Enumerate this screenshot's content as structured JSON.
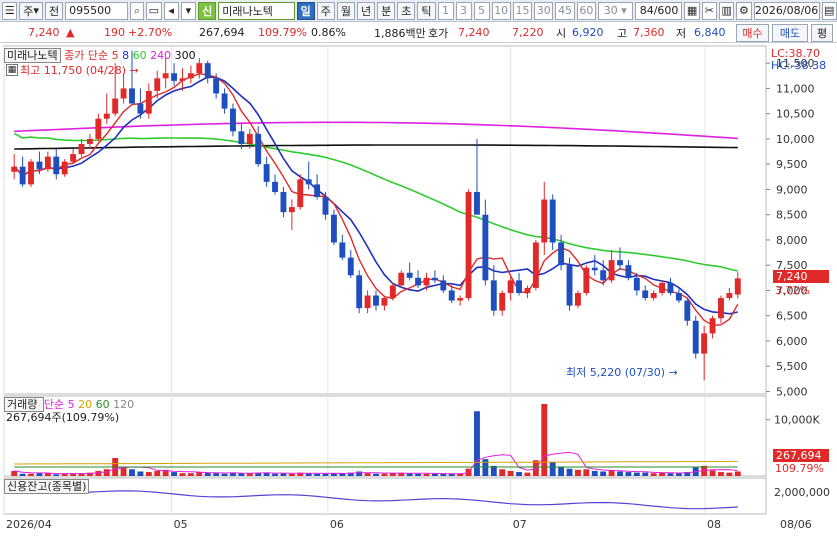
{
  "toolbar": {
    "market": "주",
    "prev": "전",
    "code": "095500",
    "badge": "신",
    "stock_name": "미래나노텍",
    "periods": [
      "일",
      "주",
      "월",
      "년",
      "분",
      "초",
      "틱"
    ],
    "active_period": "일",
    "intervals": [
      "1",
      "3",
      "5",
      "10",
      "15",
      "30",
      "45",
      "60",
      "30"
    ],
    "count": "84",
    "count_max": "/600",
    "date": "2026/08/06"
  },
  "infobar": {
    "price": "7,240",
    "arrow": "▲",
    "change": "190",
    "change_pct": "+2.70%",
    "volume": "267,694",
    "vol_ratio": "109.79%",
    "turnover": "0.86%",
    "value": "1,886백만",
    "quote_label": "호가",
    "ask": "7,240",
    "bid": "7,220",
    "open_label": "시",
    "open": "6,920",
    "high_label": "고",
    "high": "7,360",
    "low_label": "저",
    "low": "6,840",
    "buy": "매수",
    "sell": "매도",
    "eval": "평"
  },
  "legend": {
    "stock": "미래나노텍",
    "ma_label": "종가 단순",
    "ma_periods": [
      "5",
      "8",
      "60",
      "240",
      "300"
    ],
    "max_label": "최고 11,750 (04/28)",
    "min_label": "최저 5,220 (07/30)",
    "lc": "LC:38.70",
    "hc": "HC:-38.38",
    "price_tag": "7,240",
    "pct_tag": "3.72%",
    "volume_title": "거래량",
    "volume_ma_label": "단순",
    "volume_ma_periods": [
      "5",
      "20",
      "60",
      "120"
    ],
    "volume_value": "267,694주(109.79%)",
    "volume_tag": "267,694",
    "volume_pct_tag": "109.79%",
    "credit_title": "신용잔고(종목별)"
  },
  "colors": {
    "up": "#e02a2a",
    "down": "#1f4fbf",
    "ma5": "#e02a2a",
    "ma8": "#1f2fbf",
    "ma60": "#2ecc2e",
    "ma240": "#e020e0",
    "ma300": "#111111"
  },
  "chart_data": {
    "type": "candlestick",
    "x_labels": [
      "2026/04",
      "05",
      "06",
      "07",
      "08",
      "08/06"
    ],
    "price_axis_ticks": [
      "11,500",
      "11,000",
      "10,500",
      "10,000",
      "9,500",
      "9,000",
      "8,500",
      "8,000",
      "7,500",
      "7,000",
      "6,500",
      "6,000",
      "5,500",
      "5,000"
    ],
    "price_range": [
      4950,
      11800
    ],
    "volume_axis_ticks": [
      "10,000K"
    ],
    "credit_axis_ticks": [
      "2,000,000"
    ],
    "candles": [
      [
        9350,
        9700,
        9200,
        9450
      ],
      [
        9450,
        9650,
        9050,
        9100
      ],
      [
        9100,
        9600,
        9050,
        9550
      ],
      [
        9550,
        9750,
        9300,
        9400
      ],
      [
        9400,
        9750,
        9350,
        9650
      ],
      [
        9650,
        9800,
        9200,
        9300
      ],
      [
        9300,
        9600,
        9250,
        9550
      ],
      [
        9550,
        9800,
        9500,
        9700
      ],
      [
        9700,
        10000,
        9650,
        9900
      ],
      [
        9900,
        10100,
        9800,
        10000
      ],
      [
        10000,
        10500,
        9950,
        10400
      ],
      [
        10400,
        10900,
        10300,
        10500
      ],
      [
        10500,
        11500,
        10450,
        10800
      ],
      [
        10800,
        11300,
        10700,
        11000
      ],
      [
        11000,
        11750,
        10800,
        10700
      ],
      [
        10700,
        11000,
        10400,
        10500
      ],
      [
        10500,
        11100,
        10400,
        10950
      ],
      [
        10950,
        11350,
        10800,
        11200
      ],
      [
        11200,
        11600,
        11000,
        11300
      ],
      [
        11300,
        11500,
        11050,
        11150
      ],
      [
        11150,
        11400,
        10950,
        11200
      ],
      [
        11200,
        11450,
        11100,
        11300
      ],
      [
        11300,
        11600,
        11200,
        11500
      ],
      [
        11500,
        11550,
        11100,
        11200
      ],
      [
        11200,
        11300,
        10800,
        10900
      ],
      [
        10900,
        11000,
        10500,
        10600
      ],
      [
        10600,
        10700,
        10050,
        10150
      ],
      [
        10150,
        10300,
        9800,
        9900
      ],
      [
        9900,
        10200,
        9800,
        10100
      ],
      [
        10100,
        10250,
        9450,
        9500
      ],
      [
        9500,
        9650,
        9050,
        9150
      ],
      [
        9150,
        9300,
        8900,
        8950
      ],
      [
        8950,
        9050,
        8450,
        8550
      ],
      [
        8550,
        8800,
        8200,
        8650
      ],
      [
        8650,
        9300,
        8600,
        9200
      ],
      [
        9200,
        9550,
        9000,
        9100
      ],
      [
        9100,
        9300,
        8800,
        8850
      ],
      [
        8850,
        8950,
        8400,
        8500
      ],
      [
        8500,
        8600,
        7900,
        7950
      ],
      [
        7950,
        8100,
        7600,
        7650
      ],
      [
        7650,
        7800,
        7250,
        7300
      ],
      [
        7300,
        7400,
        6550,
        6650
      ],
      [
        6650,
        7000,
        6550,
        6900
      ],
      [
        6900,
        7000,
        6600,
        6700
      ],
      [
        6700,
        6900,
        6600,
        6850
      ],
      [
        6850,
        7150,
        6800,
        7100
      ],
      [
        7100,
        7400,
        7050,
        7350
      ],
      [
        7350,
        7550,
        7200,
        7250
      ],
      [
        7250,
        7400,
        7050,
        7100
      ],
      [
        7100,
        7350,
        7000,
        7250
      ],
      [
        7250,
        7400,
        7150,
        7200
      ],
      [
        7200,
        7300,
        6950,
        7000
      ],
      [
        7000,
        7100,
        6750,
        6800
      ],
      [
        6800,
        6900,
        6700,
        6850
      ],
      [
        6850,
        9000,
        6800,
        8950
      ],
      [
        8950,
        10000,
        8700,
        8500
      ],
      [
        8500,
        8800,
        7100,
        7200
      ],
      [
        7200,
        7500,
        6500,
        6600
      ],
      [
        6600,
        7000,
        6500,
        6950
      ],
      [
        6950,
        7300,
        6800,
        7200
      ],
      [
        7200,
        7350,
        6900,
        6950
      ],
      [
        6950,
        7100,
        6850,
        7050
      ],
      [
        7050,
        8000,
        7000,
        7950
      ],
      [
        7950,
        9150,
        7700,
        8800
      ],
      [
        8800,
        8900,
        7800,
        7950
      ],
      [
        7950,
        8100,
        7400,
        7500
      ],
      [
        7500,
        7650,
        6600,
        6700
      ],
      [
        6700,
        7000,
        6650,
        6950
      ],
      [
        6950,
        7500,
        6900,
        7450
      ],
      [
        7450,
        7700,
        7300,
        7400
      ],
      [
        7400,
        7600,
        7100,
        7200
      ],
      [
        7200,
        7800,
        7150,
        7600
      ],
      [
        7600,
        7850,
        7400,
        7500
      ],
      [
        7500,
        7600,
        7200,
        7250
      ],
      [
        7250,
        7350,
        6900,
        7000
      ],
      [
        7000,
        7100,
        6800,
        6850
      ],
      [
        6850,
        7000,
        6800,
        6950
      ],
      [
        6950,
        7200,
        6900,
        7150
      ],
      [
        7150,
        7250,
        6900,
        6950
      ],
      [
        6950,
        7050,
        6750,
        6800
      ],
      [
        6800,
        6850,
        6300,
        6400
      ],
      [
        6400,
        6500,
        5650,
        5750
      ],
      [
        5750,
        6300,
        5220,
        6150
      ],
      [
        6150,
        6500,
        6050,
        6450
      ],
      [
        6450,
        6900,
        6350,
        6850
      ],
      [
        6850,
        7050,
        6800,
        6950
      ],
      [
        6920,
        7360,
        6840,
        7240
      ]
    ],
    "volumes": [
      0.9,
      0.4,
      0.4,
      0.5,
      0.5,
      0.3,
      0.4,
      0.4,
      0.5,
      0.6,
      0.9,
      1.2,
      3.2,
      1.5,
      1.2,
      0.8,
      0.7,
      0.9,
      1.1,
      0.7,
      0.5,
      0.5,
      0.7,
      0.6,
      0.5,
      0.4,
      0.6,
      0.5,
      0.5,
      0.6,
      0.6,
      0.4,
      0.5,
      0.4,
      0.6,
      0.5,
      0.4,
      0.4,
      0.5,
      0.5,
      0.6,
      0.8,
      0.5,
      0.4,
      0.4,
      0.5,
      0.6,
      0.5,
      0.4,
      0.4,
      0.4,
      0.4,
      0.4,
      0.4,
      1.3,
      11.5,
      3.0,
      1.8,
      1.2,
      0.9,
      0.7,
      0.6,
      2.8,
      12.8,
      2.5,
      1.6,
      1.3,
      1.1,
      1.2,
      0.9,
      0.8,
      1.0,
      0.8,
      0.7,
      0.6,
      0.6,
      0.5,
      0.6,
      0.5,
      0.5,
      0.7,
      1.5,
      1.8,
      1.0,
      0.7,
      0.6,
      0.8
    ],
    "volume_range": [
      0,
      13500
    ]
  }
}
